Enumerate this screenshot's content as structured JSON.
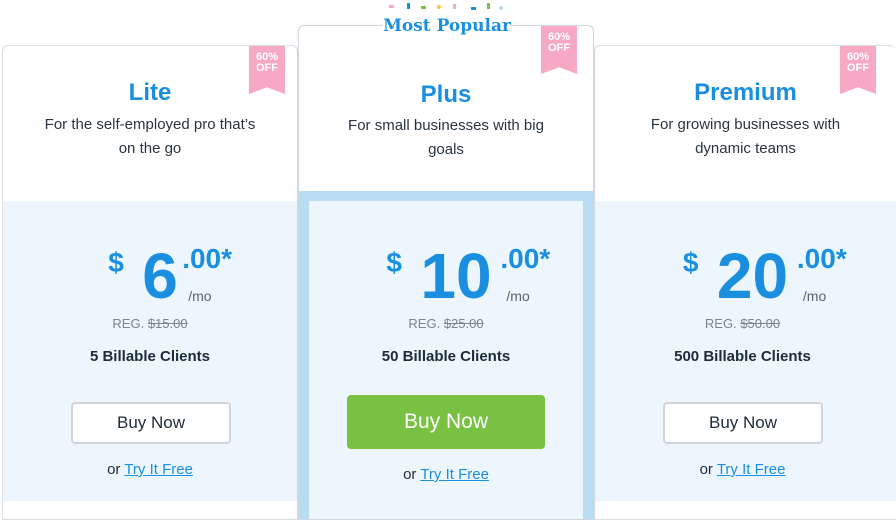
{
  "plans": [
    {
      "name": "Lite",
      "description": "For the self-employed pro that’s on the go",
      "ribbon_pct": "60%",
      "ribbon_off": "OFF",
      "currency": "$",
      "amount": "6",
      "cents": ".00*",
      "per": "/mo",
      "reg_label": "REG.",
      "reg_price": "$15.00",
      "clients": "5 Billable Clients",
      "buy_label": "Buy Now",
      "try_prefix": "or",
      "try_label": "Try It Free"
    },
    {
      "name": "Plus",
      "badge": "Most Popular",
      "description": "For small businesses with big goals",
      "ribbon_pct": "60%",
      "ribbon_off": "OFF",
      "currency": "$",
      "amount": "10",
      "cents": ".00*",
      "per": "/mo",
      "reg_label": "REG.",
      "reg_price": "$25.00",
      "clients": "50 Billable Clients",
      "buy_label": "Buy Now",
      "try_prefix": "or",
      "try_label": "Try It Free"
    },
    {
      "name": "Premium",
      "description": "For growing businesses with dynamic teams",
      "ribbon_pct": "60%",
      "ribbon_off": "OFF",
      "currency": "$",
      "amount": "20",
      "cents": ".00*",
      "per": "/mo",
      "reg_label": "REG.",
      "reg_price": "$50.00",
      "clients": "500 Billable Clients",
      "buy_label": "Buy Now",
      "try_prefix": "or",
      "try_label": "Try It Free"
    }
  ],
  "colors": {
    "accent": "#1a8fe0",
    "ribbon": "#f7a8c5",
    "price_bg": "#ecf6fc",
    "highlight_border": "#b8dcf2",
    "buy_green": "#79c142"
  }
}
